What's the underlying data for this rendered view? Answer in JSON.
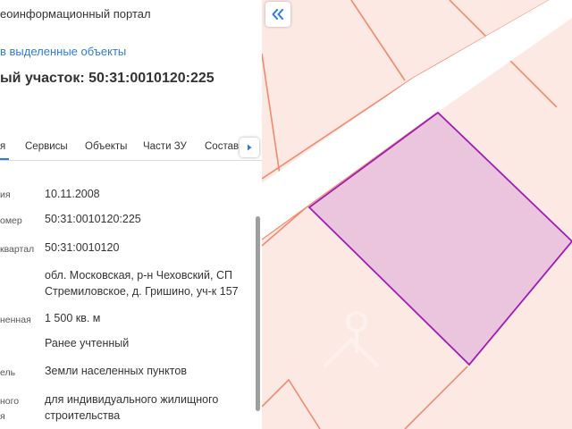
{
  "header": {
    "portal_title": "еоинформационный портал",
    "back_link": "в выделенные объекты",
    "object_title": "ый участок: 50:31:0010120:225"
  },
  "tabs": [
    {
      "label": "я",
      "active": true
    },
    {
      "label": "Сервисы",
      "active": false
    },
    {
      "label": "Объекты",
      "active": false
    },
    {
      "label": "Части ЗУ",
      "active": false
    },
    {
      "label": "Состав",
      "active": false
    }
  ],
  "details": [
    {
      "label": "ия",
      "value": "10.11.2008"
    },
    {
      "label": "омер",
      "value": "50:31:0010120:225"
    },
    {
      "label": "квартал",
      "value": "50:31:0010120"
    },
    {
      "label": "",
      "value": "обл. Московская, р-н Чеховский, СП Стремиловское, д. Гришино, уч-к 157"
    },
    {
      "label": "ненная",
      "value": "1 500 кв. м"
    },
    {
      "label": "",
      "value": "Ранее учтенный"
    },
    {
      "label": "ель",
      "value": "Земли населенных пунктов"
    },
    {
      "label": "ного",
      "value": "для индивидуального жилищного строительства"
    },
    {
      "label": "я",
      "value": ""
    }
  ],
  "icons": {
    "collapse": "chevrons-left-icon",
    "tabs_next": "triangle-right-icon"
  },
  "colors": {
    "accent": "#2f7bd8",
    "map_background": "#fde9e4",
    "parcel_fill": "#ebc4de",
    "parcel_stroke": "#a01eb4",
    "boundary_lines": "#f08a6c",
    "road": "#ffffff"
  }
}
